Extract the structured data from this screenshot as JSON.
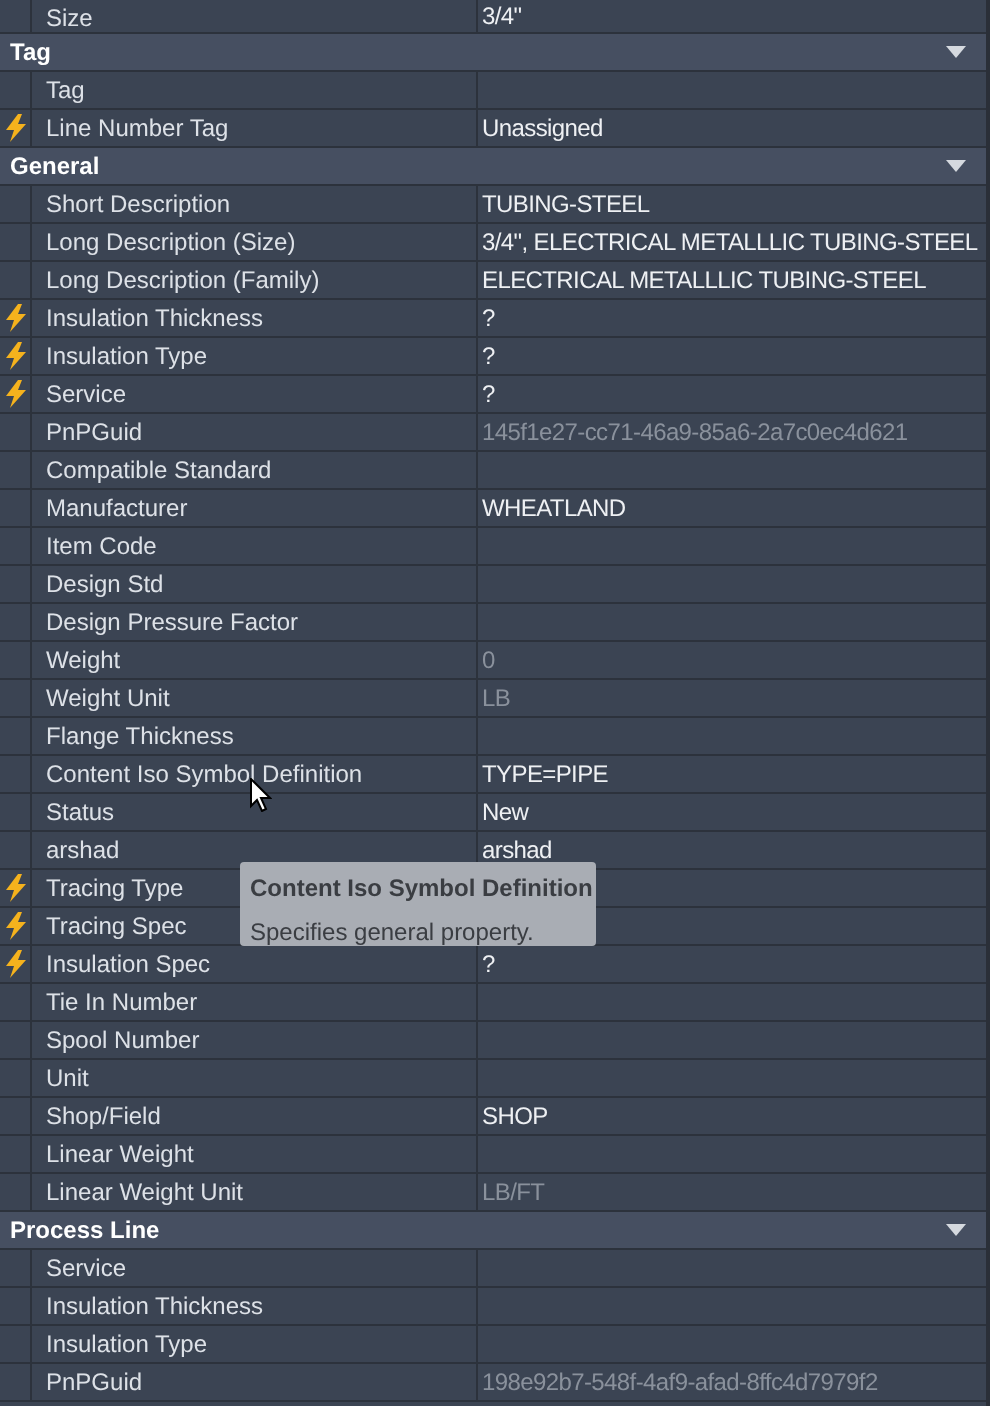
{
  "top_rows": [
    {
      "label": "Size",
      "value": "3/4\""
    }
  ],
  "sections": [
    {
      "title": "Tag",
      "expanded": true,
      "rows": [
        {
          "label": "Tag"
        },
        {
          "label": "Line Number Tag",
          "value": "Unassigned",
          "linked": true
        }
      ]
    },
    {
      "title": "General",
      "expanded": true,
      "rows": [
        {
          "label": "Short Description",
          "value": "TUBING-STEEL"
        },
        {
          "label": "Long Description (Size)",
          "value": "3/4\", ELECTRICAL METALLLIC TUBING-STEEL"
        },
        {
          "label": "Long Description (Family)",
          "value": "ELECTRICAL METALLLIC TUBING-STEEL"
        },
        {
          "label": "Insulation Thickness",
          "value": "?",
          "linked": true
        },
        {
          "label": "Insulation Type",
          "value": "?",
          "linked": true
        },
        {
          "label": "Service",
          "value": "?",
          "linked": true
        },
        {
          "label": "PnPGuid",
          "value": "145f1e27-cc71-46a9-85a6-2a7c0ec4d621",
          "readonly": true
        },
        {
          "label": "Compatible Standard"
        },
        {
          "label": "Manufacturer",
          "value": "WHEATLAND"
        },
        {
          "label": "Item Code"
        },
        {
          "label": "Design Std"
        },
        {
          "label": "Design Pressure Factor"
        },
        {
          "label": "Weight",
          "value": "0",
          "readonly": true
        },
        {
          "label": "Weight Unit",
          "value": "LB",
          "readonly": true
        },
        {
          "label": "Flange Thickness"
        },
        {
          "label": "Content Iso Symbol Definition",
          "value": "TYPE=PIPE"
        },
        {
          "label": "Status",
          "value": "New"
        },
        {
          "label": "arshad",
          "value": "arshad"
        },
        {
          "label": "Tracing Type",
          "linked": true
        },
        {
          "label": "Tracing Spec",
          "linked": true
        },
        {
          "label": "Insulation Spec",
          "value": "?",
          "linked": true
        },
        {
          "label": "Tie In Number"
        },
        {
          "label": "Spool Number"
        },
        {
          "label": "Unit"
        },
        {
          "label": "Shop/Field",
          "value": "SHOP"
        },
        {
          "label": "Linear Weight"
        },
        {
          "label": "Linear Weight Unit",
          "value": "LB/FT",
          "readonly": true
        }
      ]
    },
    {
      "title": "Process Line",
      "expanded": true,
      "rows": [
        {
          "label": "Service"
        },
        {
          "label": "Insulation Thickness"
        },
        {
          "label": "Insulation Type"
        },
        {
          "label": "PnPGuid",
          "value": "198e92b7-548f-4af9-afad-8ffc4d7979f2",
          "readonly": true
        }
      ]
    }
  ],
  "tooltip": {
    "title": "Content Iso Symbol Definition",
    "text": "Specifies general property."
  }
}
